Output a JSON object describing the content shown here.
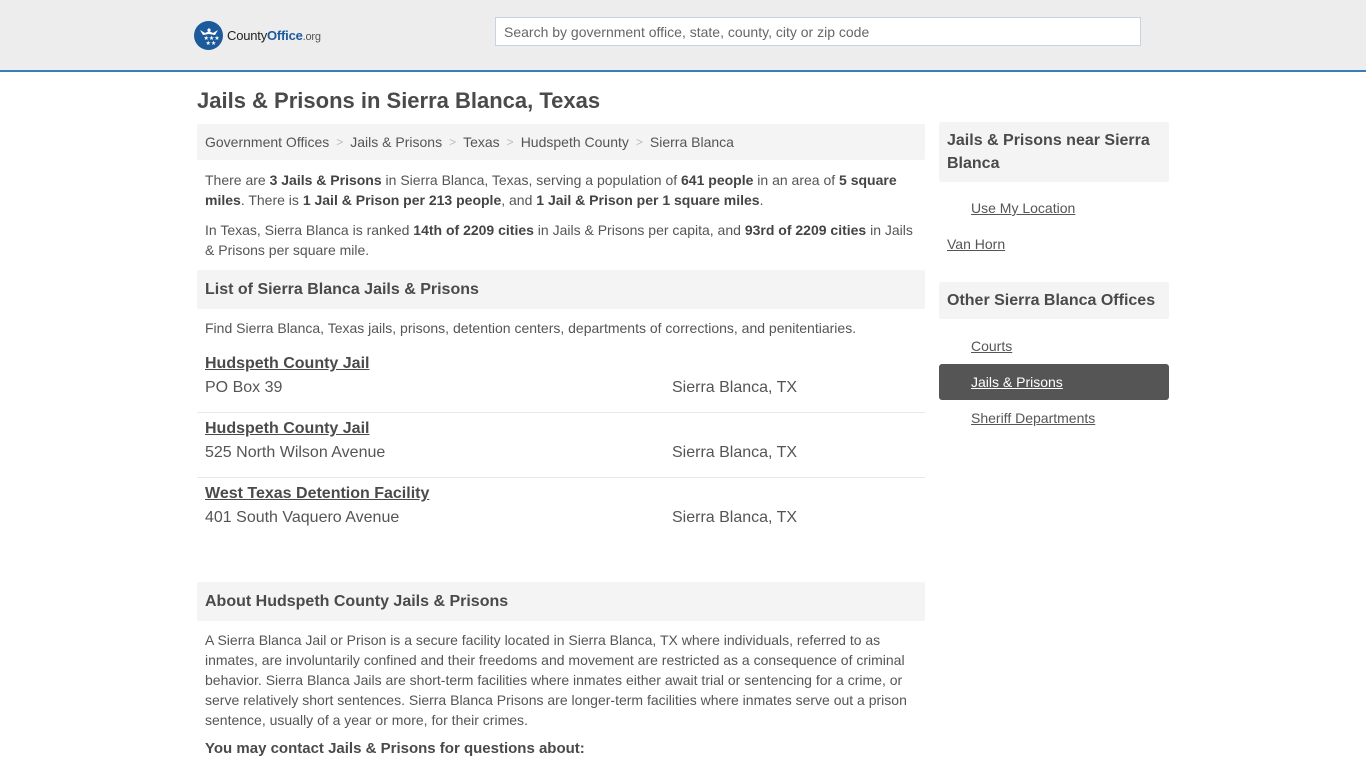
{
  "header": {
    "logo": {
      "county": "County",
      "office": "Office",
      "tld": ".org",
      "icon": "eagle-stars-badge-icon"
    },
    "search": {
      "placeholder": "Search by government office, state, county, city or zip code",
      "value": ""
    },
    "colors": {
      "accent": "#3b7db5",
      "brand": "#1c5a9c",
      "background": "#ededed"
    }
  },
  "page": {
    "title": "Jails & Prisons in Sierra Blanca, Texas"
  },
  "breadcrumb": [
    {
      "label": "Government Offices"
    },
    {
      "label": "Jails & Prisons"
    },
    {
      "label": "Texas"
    },
    {
      "label": "Hudspeth County"
    },
    {
      "label": "Sierra Blanca"
    }
  ],
  "intro": {
    "p1": {
      "t1": "There are ",
      "b1": "3 Jails & Prisons",
      "t2": " in Sierra Blanca, Texas, serving a population of ",
      "b2": "641 people",
      "t3": " in an area of ",
      "b3": "5 square miles",
      "t4": ". There is ",
      "b4": "1 Jail & Prison per 213 people",
      "t5": ", and ",
      "b5": "1 Jail & Prison per 1 square miles",
      "t6": "."
    },
    "p2": {
      "t1": "In Texas, Sierra Blanca is ranked ",
      "b1": "14th of 2209 cities",
      "t2": " in Jails & Prisons per capita, and ",
      "b2": "93rd of 2209 cities",
      "t3": " in Jails & Prisons per square mile."
    }
  },
  "list_section": {
    "heading": "List of Sierra Blanca Jails & Prisons",
    "description": "Find Sierra Blanca, Texas jails, prisons, detention centers, departments of corrections, and penitentiaries.",
    "items": [
      {
        "name": "Hudspeth County Jail",
        "address": "PO Box 39",
        "city": "Sierra Blanca, TX"
      },
      {
        "name": "Hudspeth County Jail",
        "address": "525 North Wilson Avenue",
        "city": "Sierra Blanca, TX"
      },
      {
        "name": "West Texas Detention Facility",
        "address": "401 South Vaquero Avenue",
        "city": "Sierra Blanca, TX"
      }
    ]
  },
  "about_section": {
    "heading": "About Hudspeth County Jails & Prisons",
    "text": "A Sierra Blanca Jail or Prison is a secure facility located in Sierra Blanca, TX where individuals, referred to as inmates, are involuntarily confined and their freedoms and movement are restricted as a consequence of criminal behavior. Sierra Blanca Jails are short-term facilities where inmates either await trial or sentencing for a crime, or serve relatively short sentences. Sierra Blanca Prisons are longer-term facilities where inmates serve out a prison sentence, usually of a year or more, for their crimes.",
    "contact_heading": "You may contact Jails & Prisons for questions about:"
  },
  "sidebar": {
    "nearby": {
      "heading": "Jails & Prisons near Sierra Blanca",
      "use_location": "Use My Location",
      "places": [
        {
          "label": "Van Horn"
        }
      ]
    },
    "other": {
      "heading": "Other Sierra Blanca Offices",
      "items": [
        {
          "label": "Courts",
          "active": false
        },
        {
          "label": "Jails & Prisons",
          "active": true
        },
        {
          "label": "Sheriff Departments",
          "active": false
        }
      ]
    }
  }
}
